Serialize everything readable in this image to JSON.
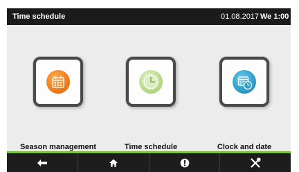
{
  "header": {
    "title": "Time schedule",
    "date": "01.08.2017",
    "time": "We 1:00"
  },
  "tiles": [
    {
      "label": "Season management",
      "icon": "calendar-icon",
      "color": "#f07a16"
    },
    {
      "label": "Time schedule",
      "icon": "clock-icon",
      "color": "#b8d98a"
    },
    {
      "label": "Clock and date",
      "icon": "calendar-clock-icon",
      "color": "#2e9ec8"
    }
  ],
  "footer": {
    "accent": "#7cc243",
    "buttons": [
      "back-icon",
      "home-icon",
      "info-icon",
      "tools-icon"
    ]
  }
}
